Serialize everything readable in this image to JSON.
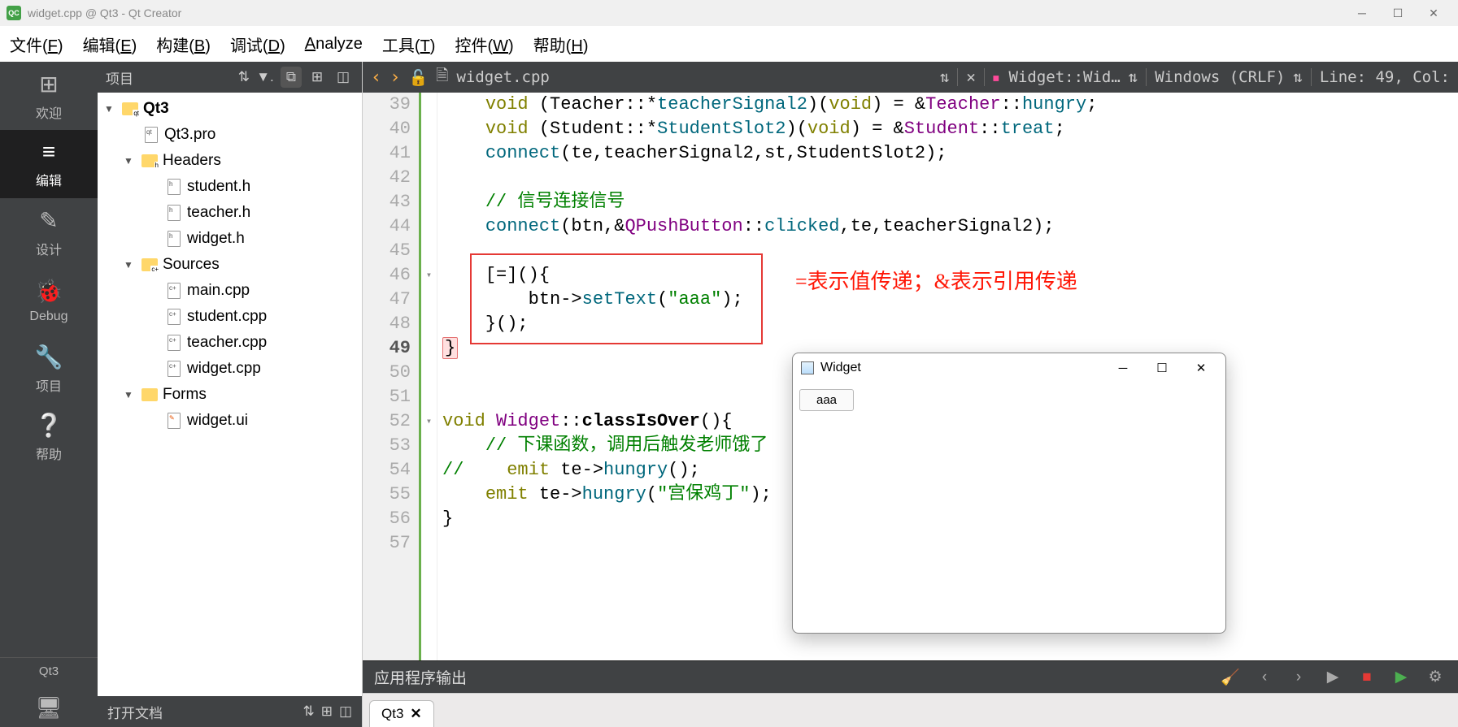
{
  "titlebar": {
    "text": "widget.cpp @ Qt3 - Qt Creator",
    "iconText": "QC"
  },
  "menubar": {
    "file": "文件(F)",
    "edit": "编辑(E)",
    "build": "构建(B)",
    "debug": "调试(D)",
    "analyze": "Analyze",
    "tools": "工具(T)",
    "widgets": "控件(W)",
    "help": "帮助(H)"
  },
  "leftbar": {
    "welcome": "欢迎",
    "edit": "编辑",
    "design": "设计",
    "debug": "Debug",
    "project": "项目",
    "help": "帮助",
    "kit": "Qt3"
  },
  "projectPanel": {
    "title": "项目",
    "tree": {
      "root": "Qt3",
      "pro": "Qt3.pro",
      "headers": "Headers",
      "h1": "student.h",
      "h2": "teacher.h",
      "h3": "widget.h",
      "sources": "Sources",
      "s1": "main.cpp",
      "s2": "student.cpp",
      "s3": "teacher.cpp",
      "s4": "widget.cpp",
      "forms": "Forms",
      "f1": "widget.ui"
    },
    "openDoc": "打开文档"
  },
  "editorToolbar": {
    "filename": "widget.cpp",
    "symbol": "Widget::Wid…",
    "encoding": "Windows (CRLF)",
    "position": "Line: 49, Col:"
  },
  "code": {
    "lines": [
      39,
      40,
      41,
      42,
      43,
      44,
      45,
      46,
      47,
      48,
      49,
      50,
      51,
      52,
      53,
      54,
      55,
      56,
      57
    ],
    "currentLine": 49,
    "l39_a": "void",
    "l39_b": "(Teacher::*",
    "l39_c": "teacherSignal2",
    "l39_d": ")(",
    "l39_e": "void",
    "l39_f": ") = &",
    "l39_g": "Teacher",
    "l39_h": "::",
    "l39_i": "hungry",
    "l39_j": ";",
    "l40_a": "void",
    "l40_b": "(Student::*",
    "l40_c": "StudentSlot2",
    "l40_d": ")(",
    "l40_e": "void",
    "l40_f": ") = &",
    "l40_g": "Student",
    "l40_h": "::",
    "l40_i": "treat",
    "l40_j": ";",
    "l41_a": "connect",
    "l41_b": "(te,teacherSignal2,st,StudentSlot2);",
    "l43": "// 信号连接信号",
    "l44_a": "connect",
    "l44_b": "(btn,&",
    "l44_c": "QPushButton",
    "l44_d": "::",
    "l44_e": "clicked",
    "l44_f": ",te,teacherSignal2);",
    "l46": "[=](){",
    "l47_a": "btn",
    "l47_b": "->",
    "l47_c": "setText",
    "l47_d": "(",
    "l47_e": "\"aaa\"",
    "l47_f": ");",
    "l48": "}();",
    "l49": "}",
    "l52_a": "void",
    "l52_b": "Widget",
    "l52_c": "::",
    "l52_d": "classIsOver",
    "l52_e": "(){",
    "l53": "// 下课函数，调用后触发老师饿了",
    "l54_a": "//",
    "l54_b": "emit",
    "l54_c": "te->",
    "l54_d": "hungry",
    "l54_e": "();",
    "l55_a": "emit",
    "l55_b": "te->",
    "l55_c": "hungry",
    "l55_d": "(",
    "l55_e": "\"宫保鸡丁\"",
    "l55_f": ");",
    "l56": "}"
  },
  "annotation": "=表示值传递；&表示引用传递",
  "outputBar": {
    "title": "应用程序输出"
  },
  "outputTab": {
    "name": "Qt3"
  },
  "popup": {
    "title": "Widget",
    "buttonText": "aaa"
  }
}
